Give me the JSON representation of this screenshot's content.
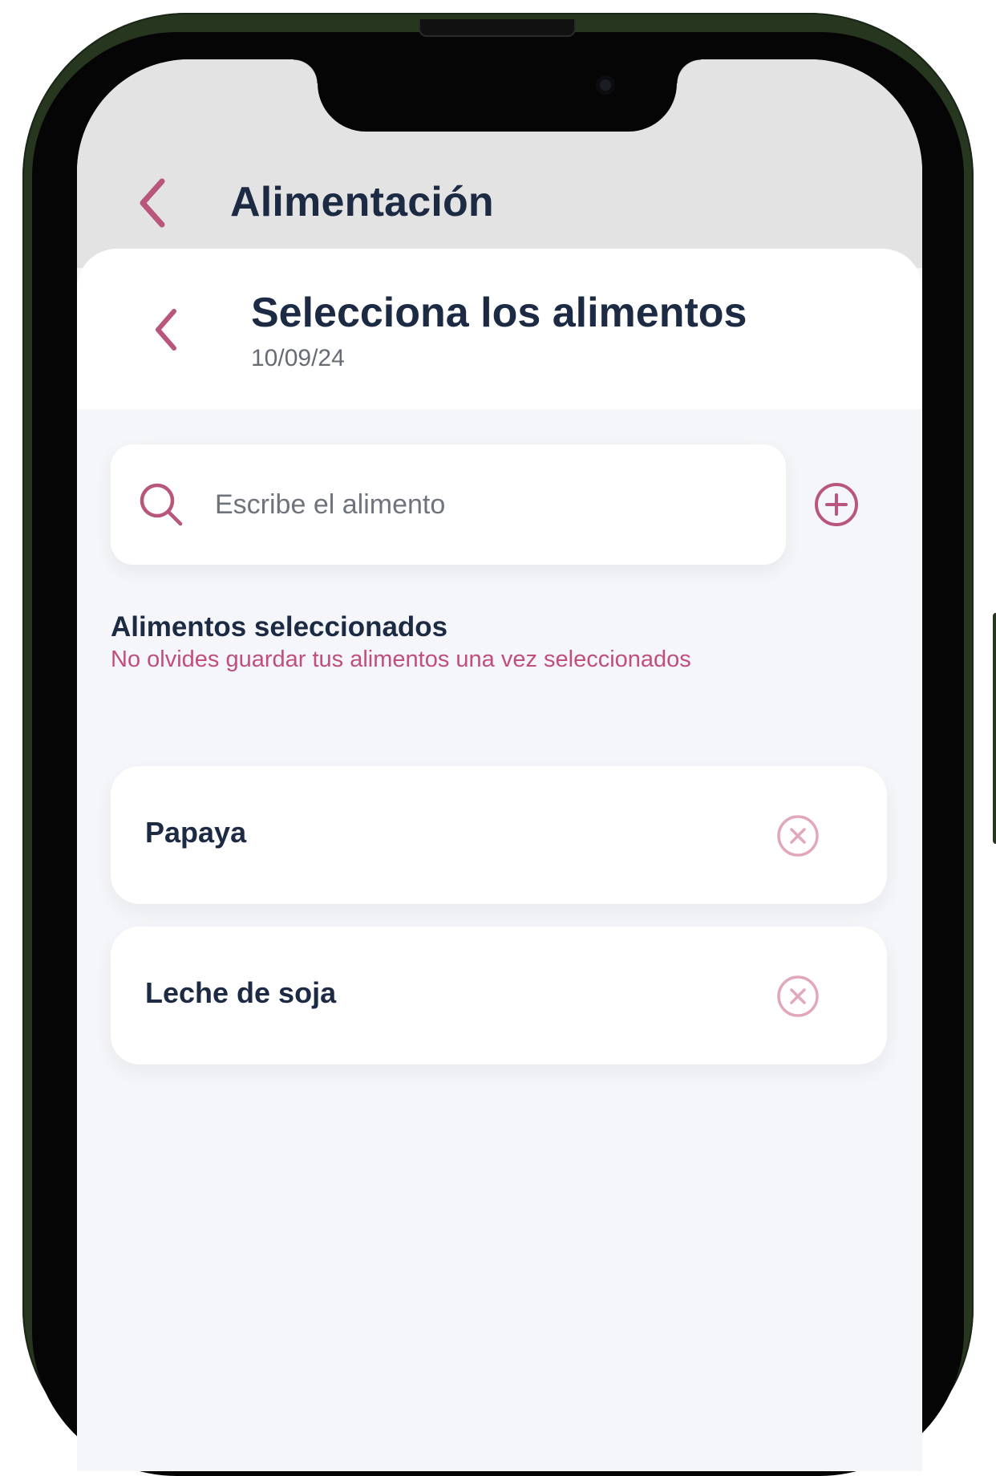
{
  "app": {
    "title": "Alimentación"
  },
  "sheet": {
    "title": "Selecciona los alimentos",
    "date": "10/09/24"
  },
  "search": {
    "placeholder": "Escribe el alimento",
    "value": ""
  },
  "selected": {
    "title": "Alimentos seleccionados",
    "hint": "No olvides guardar tus alimentos una vez seleccionados",
    "items": [
      {
        "name": "Papaya"
      },
      {
        "name": "Leche de soja"
      }
    ]
  },
  "icons": {
    "top_back": "chevron-left-icon",
    "sheet_back": "chevron-left-icon",
    "search": "search-icon",
    "add": "plus-circle-icon",
    "remove": "close-circle-icon"
  },
  "colors": {
    "accent": "#b8567c",
    "accent_light": "#e2a7bd",
    "text_primary": "#1c2b43",
    "text_secondary": "#676b73",
    "hint": "#c04f7b",
    "background": "#f5f6f9",
    "top_bar": "#e3e3e4",
    "frame": "#26361f"
  }
}
